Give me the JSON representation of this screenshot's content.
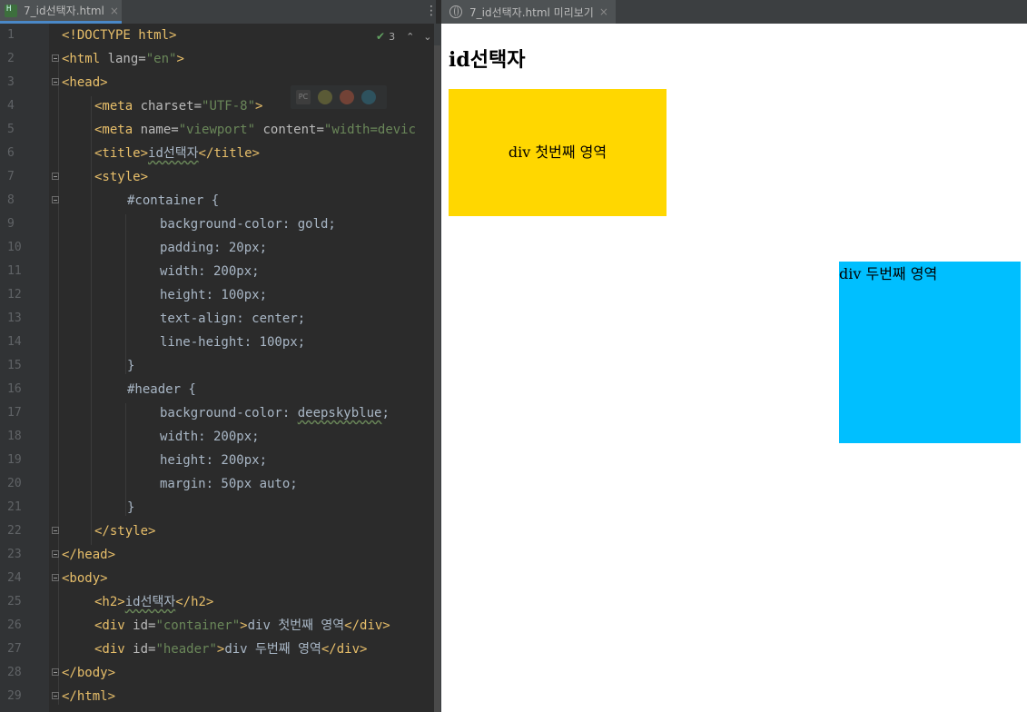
{
  "left_tab": {
    "label": "7_id선택자.html",
    "close": "×"
  },
  "right_tab": {
    "label": "7_id선택자.html 미리보기",
    "close": "×"
  },
  "inspection": {
    "count": "3",
    "check": "✔"
  },
  "browser_icons": {
    "pc": "PC"
  },
  "lines": [
    {
      "n": "1"
    },
    {
      "n": "2"
    },
    {
      "n": "3"
    },
    {
      "n": "4"
    },
    {
      "n": "5"
    },
    {
      "n": "6"
    },
    {
      "n": "7"
    },
    {
      "n": "8"
    },
    {
      "n": "9"
    },
    {
      "n": "10"
    },
    {
      "n": "11"
    },
    {
      "n": "12"
    },
    {
      "n": "13"
    },
    {
      "n": "14"
    },
    {
      "n": "15"
    },
    {
      "n": "16"
    },
    {
      "n": "17"
    },
    {
      "n": "18"
    },
    {
      "n": "19"
    },
    {
      "n": "20"
    },
    {
      "n": "21"
    },
    {
      "n": "22"
    },
    {
      "n": "23"
    },
    {
      "n": "24"
    },
    {
      "n": "25"
    },
    {
      "n": "26"
    },
    {
      "n": "27"
    },
    {
      "n": "28"
    },
    {
      "n": "29"
    }
  ],
  "code": {
    "l1": "<!DOCTYPE html>",
    "l2_a": "<html ",
    "l2_b": "lang=",
    "l2_c": "\"en\"",
    "l2_d": ">",
    "l3": "<head>",
    "l4_a": "<meta ",
    "l4_b": "charset=",
    "l4_c": "\"UTF-8\"",
    "l4_d": ">",
    "l5_a": "<meta ",
    "l5_b": "name=",
    "l5_c": "\"viewport\"",
    "l5_d": " content=",
    "l5_e": "\"width=devic",
    "l6_a": "<title>",
    "l6_b": "id선택자",
    "l6_c": "</title>",
    "l7": "<style>",
    "l8": "#container {",
    "l9": "background-color: gold;",
    "l10": "padding: 20px;",
    "l11": "width: 200px;",
    "l12": "height: 100px;",
    "l13": "text-align: center;",
    "l14": "line-height: 100px;",
    "l15": "}",
    "l16": "#header {",
    "l17_a": "background-color: ",
    "l17_b": "deepskyblue",
    "l17_c": ";",
    "l18": "width: 200px;",
    "l19": "height: 200px;",
    "l20": "margin: 50px auto;",
    "l21": "}",
    "l22": "</style>",
    "l23": "</head>",
    "l24": "<body>",
    "l25_a": "<h2>",
    "l25_b": "id선택자",
    "l25_c": "</h2>",
    "l26_a": "<div ",
    "l26_b": "id=",
    "l26_c": "\"container\"",
    "l26_d": ">",
    "l26_e": "div 첫번째 영역",
    "l26_f": "</div>",
    "l27_a": "<div ",
    "l27_b": "id=",
    "l27_c": "\"header\"",
    "l27_d": ">",
    "l27_e": "div 두번째 영역",
    "l27_f": "</div>",
    "l28": "</body>",
    "l29": "</html>"
  },
  "preview": {
    "heading": "id선택자",
    "container_text": "div 첫번째 영역",
    "header_text": "div 두번째 영역",
    "colors": {
      "container": "#ffd700",
      "header": "#00bfff"
    }
  }
}
